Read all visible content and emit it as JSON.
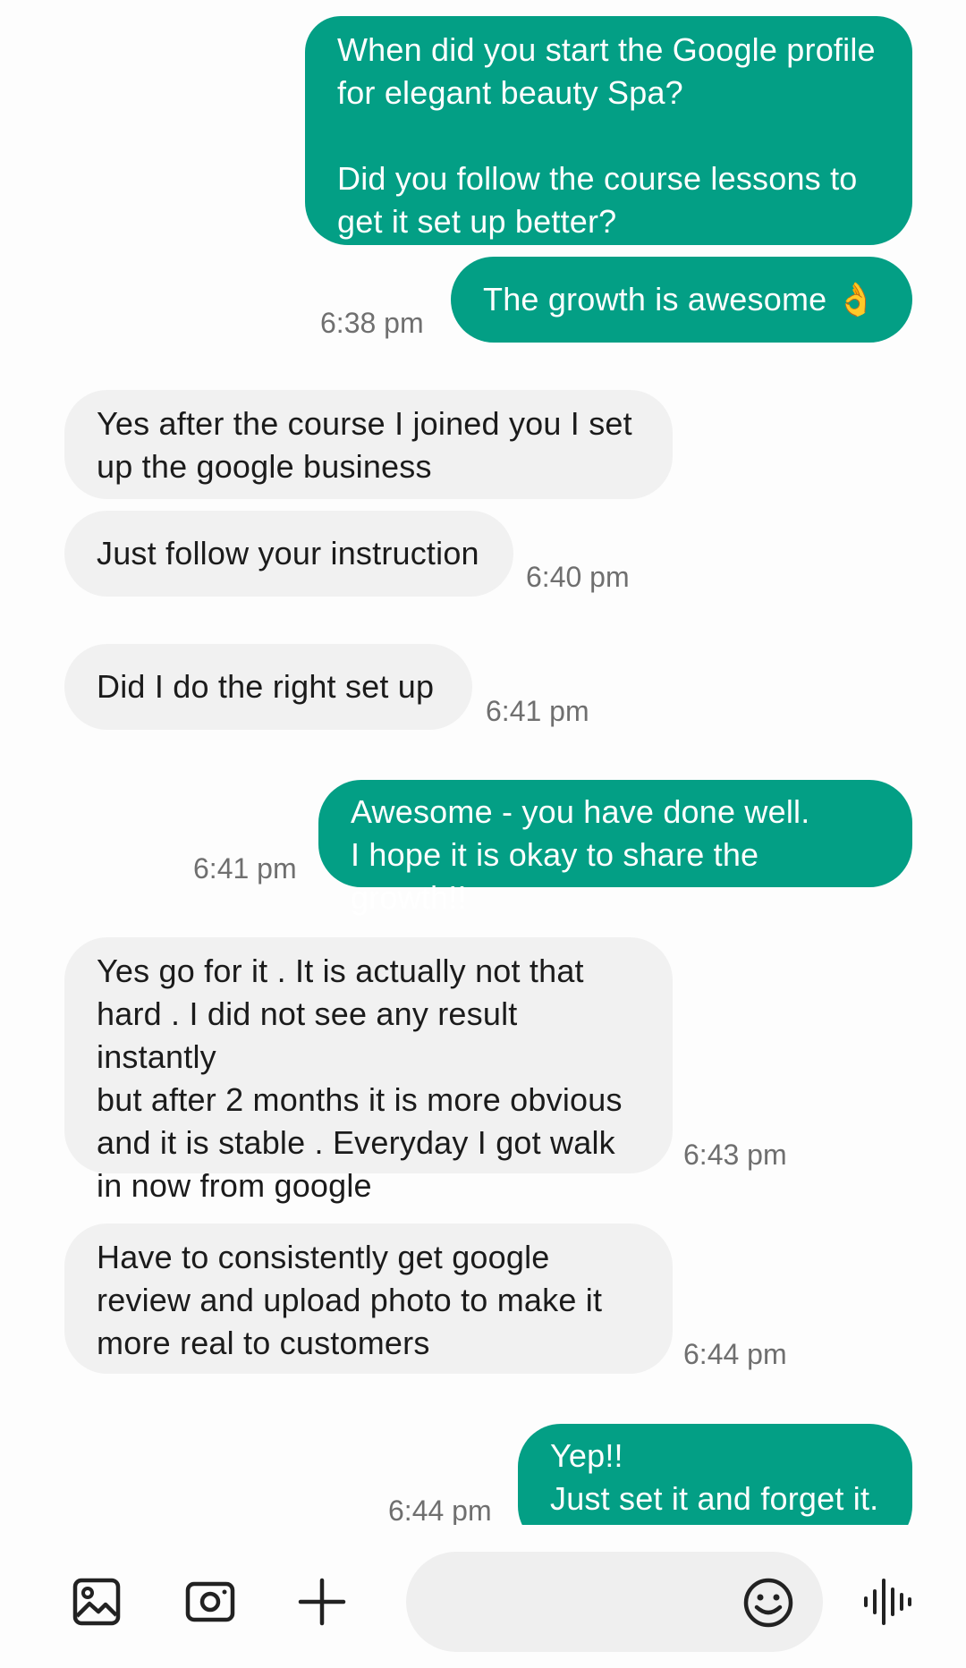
{
  "messages": [
    {
      "direction": "sent",
      "text": "When did you start the Google profile\nfor elegant beauty Spa?\n\nDid you follow the course lessons to\nget it set up better?",
      "time": ""
    },
    {
      "direction": "sent",
      "text": "The growth is awesome 👌",
      "time": "6:38 pm"
    },
    {
      "direction": "received",
      "text": "Yes after the course I joined you I set\nup the google business",
      "time": ""
    },
    {
      "direction": "received",
      "text": "Just follow your instruction",
      "time": "6:40 pm"
    },
    {
      "direction": "received",
      "text": "Did I do the right set up",
      "time": "6:41 pm"
    },
    {
      "direction": "sent",
      "text": "Awesome  - you have done well.\nI hope it is okay to share the growth!!",
      "time": "6:41 pm"
    },
    {
      "direction": "received",
      "text": "Yes go for it . It is actually not that\nhard . I did not see any result instantly\nbut after 2 months it is more obvious\nand it is stable . Everyday I got walk\nin now from google",
      "time": "6:43 pm"
    },
    {
      "direction": "received",
      "text": "Have to consistently get google\nreview and upload photo to make it\nmore real to customers",
      "time": "6:44 pm"
    },
    {
      "direction": "sent",
      "text": "Yep!!\nJust set it and forget it.",
      "time": "6:44 pm"
    }
  ],
  "composer": {
    "input_value": "",
    "icons": [
      "gallery-icon",
      "camera-icon",
      "plus-icon",
      "emoji-icon",
      "voice-icon"
    ]
  },
  "colors": {
    "sent_bubble": "#039f85",
    "received_bubble": "#f1f1f1",
    "background": "#fdfdfd",
    "timestamp": "#6f6f6f"
  }
}
